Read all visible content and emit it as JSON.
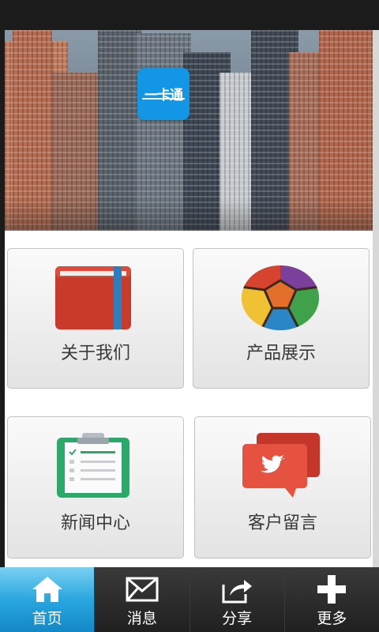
{
  "banner": {
    "logo_text": "一卡通"
  },
  "tiles": [
    {
      "label": "关于我们",
      "icon": "book-icon"
    },
    {
      "label": "产品展示",
      "icon": "colorful-logo-icon"
    },
    {
      "label": "新闻中心",
      "icon": "clipboard-icon"
    },
    {
      "label": "客户留言",
      "icon": "twitter-chat-icon"
    }
  ],
  "tabbar": {
    "items": [
      {
        "label": "首页",
        "icon": "home-icon",
        "active": true
      },
      {
        "label": "消息",
        "icon": "envelope-icon"
      },
      {
        "label": "分享",
        "icon": "share-icon"
      },
      {
        "label": "更多",
        "icon": "plus-icon"
      }
    ]
  },
  "colors": {
    "accent": "#1396e6",
    "tab_active": "#2aa6df",
    "tab_bg": "#1d1d1d"
  }
}
